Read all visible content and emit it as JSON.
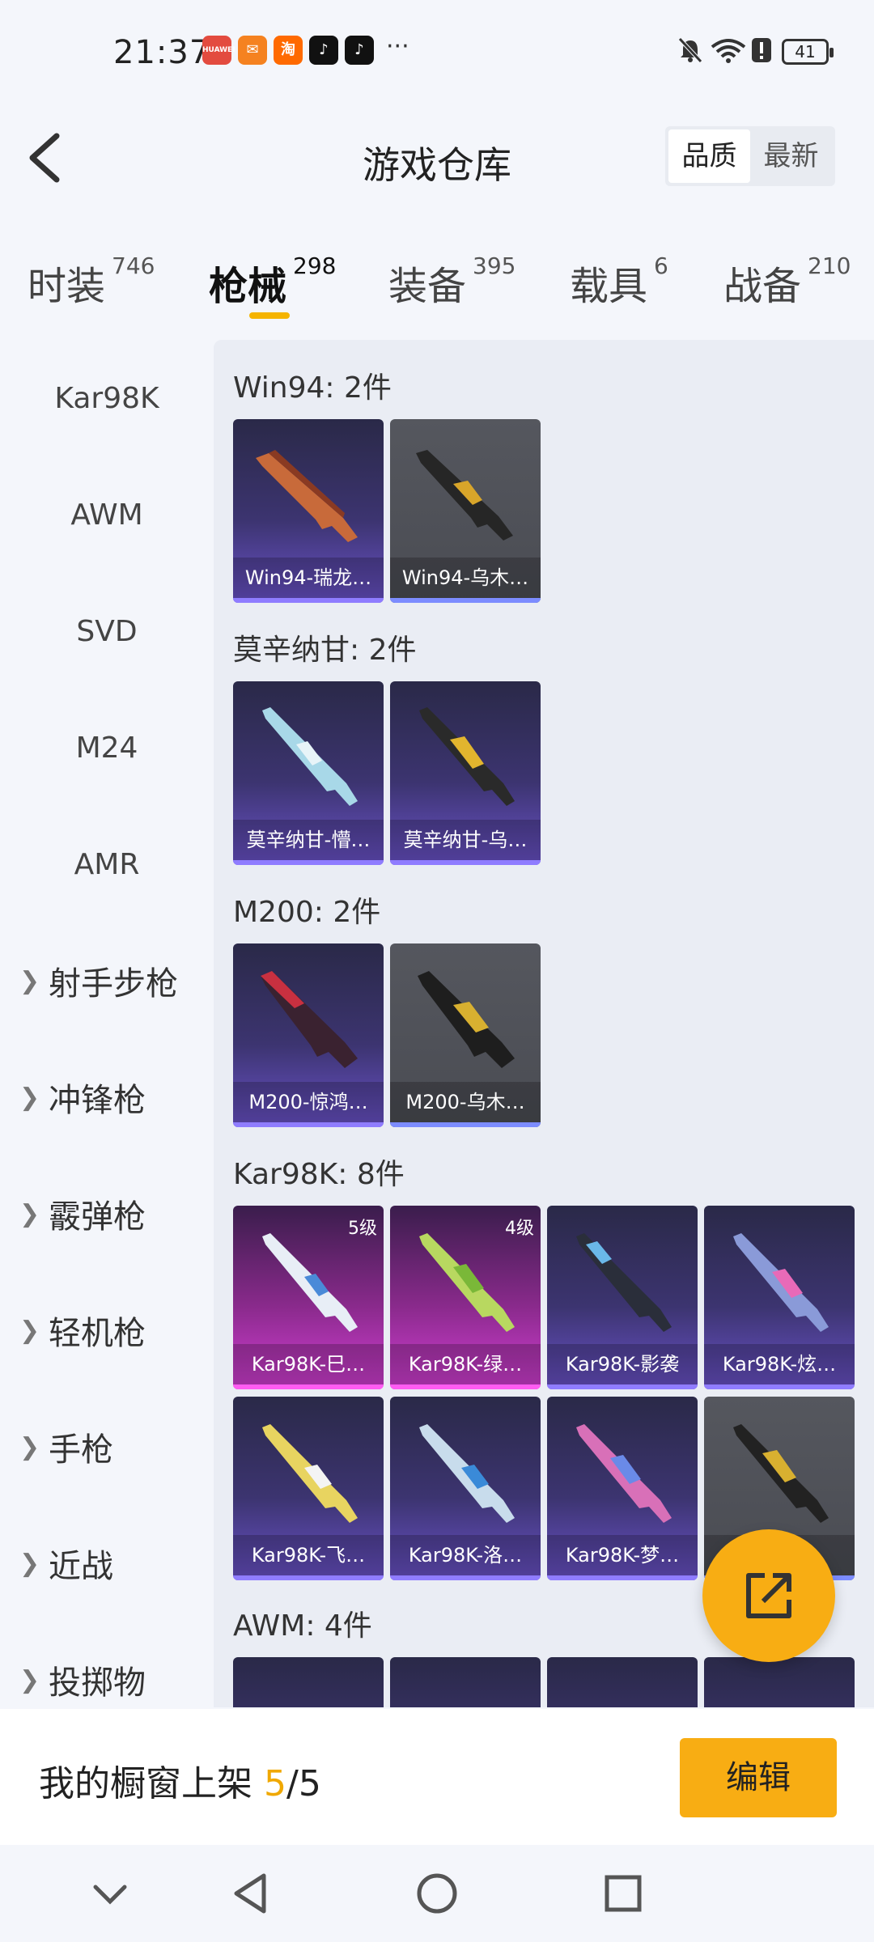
{
  "status_bar": {
    "time": "21:37",
    "apps": [
      {
        "icon": "huawei-app-icon",
        "text": "HUAWEI",
        "color": "#e34b3f"
      },
      {
        "icon": "store-app-icon",
        "text": "✉",
        "color": "#f58220"
      },
      {
        "icon": "taobao-app-icon",
        "text": "淘",
        "color": "#ff6a00"
      },
      {
        "icon": "tiktok-app-icon",
        "text": "♪",
        "color": "#111111"
      },
      {
        "icon": "tiktok-lite-app-icon",
        "text": "♪",
        "color": "#111111"
      }
    ],
    "more": "···",
    "battery": "41"
  },
  "header": {
    "title": "游戏仓库",
    "sort_options": [
      "品质",
      "最新"
    ],
    "sort_active": "品质"
  },
  "tabs": [
    {
      "label": "时装",
      "count": "746"
    },
    {
      "label": "枪械",
      "count": "298"
    },
    {
      "label": "装备",
      "count": "395"
    },
    {
      "label": "载具",
      "count": "6"
    },
    {
      "label": "战备",
      "count": "210"
    }
  ],
  "left_nav": {
    "items": [
      "Kar98K",
      "AWM",
      "SVD",
      "M24",
      "AMR"
    ],
    "groups": [
      "射手步枪",
      "冲锋枪",
      "霰弹枪",
      "轻机枪",
      "手枪",
      "近战",
      "投掷物"
    ]
  },
  "sections": [
    {
      "title": "Win94: 2件",
      "cards": [
        {
          "name": "Win94-瑞龙…",
          "tier": "purple"
        },
        {
          "name": "Win94-乌木…",
          "tier": "grey"
        }
      ]
    },
    {
      "title": "莫辛纳甘: 2件",
      "cards": [
        {
          "name": "莫辛纳甘-懵…",
          "tier": "purple"
        },
        {
          "name": "莫辛纳甘-乌…",
          "tier": "purple"
        }
      ]
    },
    {
      "title": "M200: 2件",
      "cards": [
        {
          "name": "M200-惊鸿…",
          "tier": "purple"
        },
        {
          "name": "M200-乌木…",
          "tier": "grey"
        }
      ]
    },
    {
      "title": "Kar98K: 8件",
      "cards": [
        {
          "name": "Kar98K-巳…",
          "tier": "pink",
          "level": "5级"
        },
        {
          "name": "Kar98K-绿…",
          "tier": "pink",
          "level": "4级"
        },
        {
          "name": "Kar98K-影袭",
          "tier": "purple"
        },
        {
          "name": "Kar98K-炫…",
          "tier": "purple"
        },
        {
          "name": "Kar98K-飞…",
          "tier": "purple"
        },
        {
          "name": "Kar98K-洛…",
          "tier": "purple"
        },
        {
          "name": "Kar98K-梦…",
          "tier": "purple"
        },
        {
          "name": "…",
          "tier": "grey"
        }
      ]
    },
    {
      "title": "AWM: 4件",
      "cards": []
    }
  ],
  "bottom": {
    "label_prefix": "我的橱窗上架 ",
    "count": "5",
    "total": "/5",
    "edit_label": "编辑"
  }
}
